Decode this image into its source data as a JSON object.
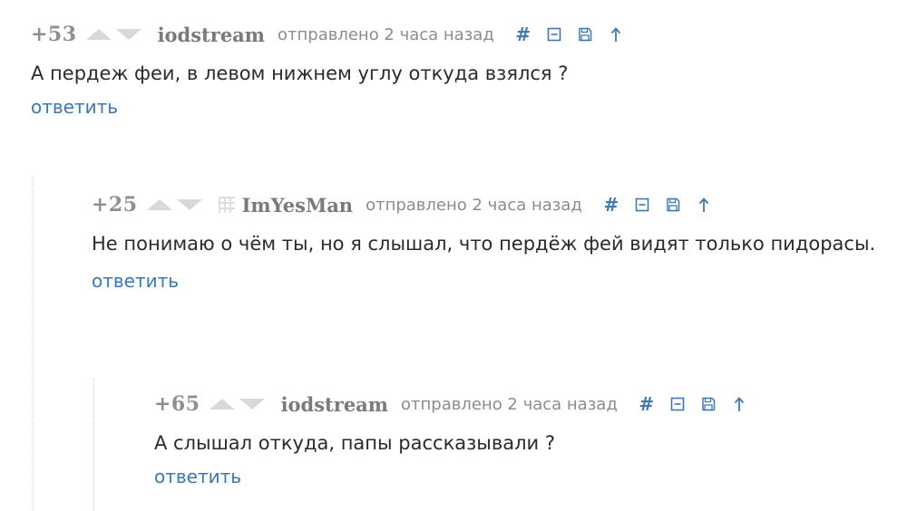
{
  "comments": [
    {
      "rating": "+53",
      "username": "iodstream",
      "sent": "отправлено 2 часа назад",
      "text": "А пердеж феи, в левом нижнем углу откуда взялся ?",
      "reply": "ответить",
      "avatar": false
    },
    {
      "rating": "+25",
      "username": "ImYesMan",
      "sent": "отправлено 2 часа назад",
      "text": "Не понимаю о чём ты, но я слышал, что пердёж фей видят только пидорасы.",
      "reply": "ответить",
      "avatar": true
    },
    {
      "rating": "+65",
      "username": "iodstream",
      "sent": "отправлено 2 часа назад",
      "text": "А слышал откуда, папы рассказывали ?",
      "reply": "ответить",
      "avatar": false
    }
  ],
  "toolbar": {
    "link_icon": "hash-link-icon",
    "collapse_icon": "minus-square-icon",
    "save_icon": "floppy-disk-icon",
    "parent_icon": "arrow-up-icon",
    "link_glyph": "#"
  },
  "colors": {
    "link": "#3b77b3",
    "username": "#7a7a7a",
    "rating": "#8f8f8f",
    "vote_arrow": "#d9d9d9",
    "thread_line": "#cfcfcf"
  }
}
